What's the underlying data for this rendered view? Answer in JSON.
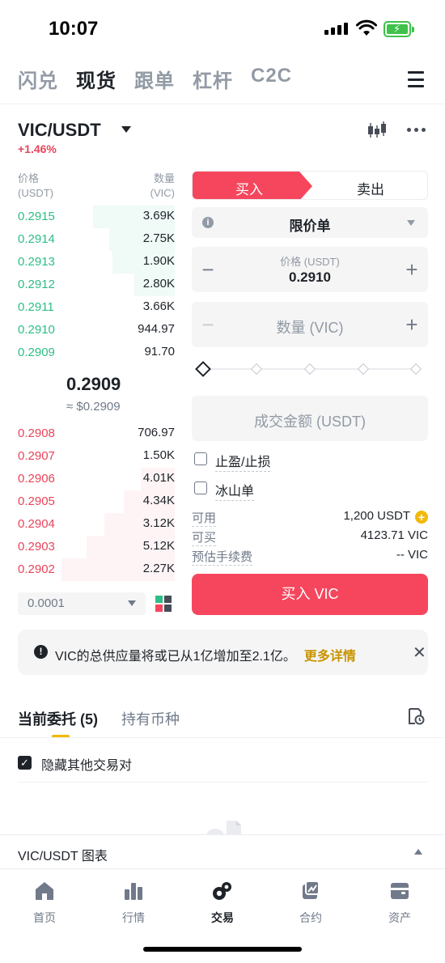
{
  "status": {
    "time": "10:07"
  },
  "top_tabs": [
    "闪兑",
    "现货",
    "跟单",
    "杠杆",
    "C2C"
  ],
  "active_top_tab": "现货",
  "pair": {
    "name": "VIC/USDT",
    "change": "+1.46%"
  },
  "orderbook": {
    "price_header": "价格",
    "price_unit": "(USDT)",
    "qty_header": "数量",
    "qty_unit": "(VIC)",
    "asks": [
      {
        "price": "0.2915",
        "qty": "3.69K",
        "depth": 0.72
      },
      {
        "price": "0.2914",
        "qty": "2.75K",
        "depth": 0.58
      },
      {
        "price": "0.2913",
        "qty": "1.90K",
        "depth": 0.55
      },
      {
        "price": "0.2912",
        "qty": "2.80K",
        "depth": 0.36
      },
      {
        "price": "0.2911",
        "qty": "3.66K",
        "depth": 0.0
      },
      {
        "price": "0.2910",
        "qty": "944.97",
        "depth": 0.0
      },
      {
        "price": "0.2909",
        "qty": "91.70",
        "depth": 0.0
      }
    ],
    "last_price": "0.2909",
    "last_fiat": "≈ $0.2909",
    "bids": [
      {
        "price": "0.2908",
        "qty": "706.97",
        "depth": 0.0
      },
      {
        "price": "0.2907",
        "qty": "1.50K",
        "depth": 0.0
      },
      {
        "price": "0.2906",
        "qty": "4.01K",
        "depth": 0.3
      },
      {
        "price": "0.2905",
        "qty": "4.34K",
        "depth": 0.45
      },
      {
        "price": "0.2904",
        "qty": "3.12K",
        "depth": 0.62
      },
      {
        "price": "0.2903",
        "qty": "5.12K",
        "depth": 0.78
      },
      {
        "price": "0.2902",
        "qty": "2.27K",
        "depth": 1.0
      }
    ],
    "depth_precision": "0.0001"
  },
  "trade": {
    "buy_label": "买入",
    "sell_label": "卖出",
    "order_type": "限价单",
    "price_caption": "价格 (USDT)",
    "price_value": "0.2910",
    "qty_placeholder": "数量 (VIC)",
    "total_placeholder": "成交金额 (USDT)",
    "tp_sl_label": "止盈/止损",
    "iceberg_label": "冰山单",
    "available_key": "可用",
    "available_val": "1,200 USDT",
    "can_buy_key": "可买",
    "can_buy_val": "4123.71 VIC",
    "fee_key": "预估手续费",
    "fee_val": "-- VIC",
    "submit_label": "买入 VIC"
  },
  "notice": {
    "text": "VIC的总供应量将或已从1亿增加至2.1亿。",
    "link": "更多详情"
  },
  "orders": {
    "tab_open": "当前委托 (5)",
    "tab_holdings": "持有币种",
    "hide_others": "隐藏其他交易对"
  },
  "chart_bar": {
    "label": "VIC/USDT 图表"
  },
  "bottom_nav": [
    {
      "label": "首页",
      "icon": "home-icon"
    },
    {
      "label": "行情",
      "icon": "markets-icon"
    },
    {
      "label": "交易",
      "icon": "trade-icon"
    },
    {
      "label": "合约",
      "icon": "futures-icon"
    },
    {
      "label": "资产",
      "icon": "wallet-icon"
    }
  ],
  "active_nav": "交易",
  "colors": {
    "buy": "#f6465d",
    "ask_green": "#2ebd85",
    "accent": "#f0b90b"
  }
}
